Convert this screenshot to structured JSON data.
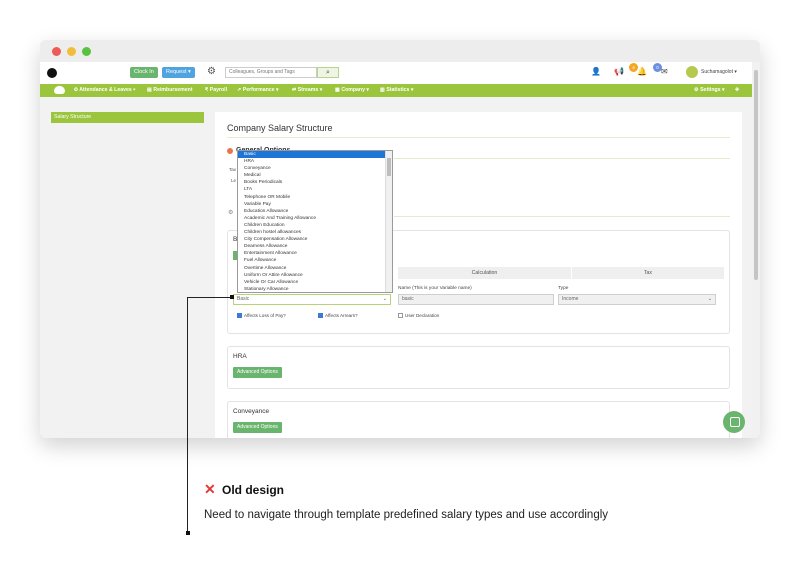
{
  "header": {
    "clock_in": "Clock In",
    "request": "Request ▾",
    "search_placeholder": "Colleagues, Groups and Tags",
    "notif_count_1": "4",
    "notif_count_2": "0",
    "username": "Suchamagolot ▾"
  },
  "nav": {
    "items": [
      "Attendance & Leaves ▾",
      "Reimbursement",
      "Payroll",
      "Performance ▾",
      "Streams ▾",
      "Company ▾",
      "Statistics ▾"
    ],
    "settings": "Settings ▾"
  },
  "sidebar": {
    "items": [
      {
        "label": "Salary Structure"
      }
    ]
  },
  "main": {
    "title": "Company Salary Structure",
    "section_general": "General Options",
    "general_label_1": "Tax",
    "general_label_2": "Le",
    "basic_panel": {
      "label": "B",
      "columns": [
        "Calculation",
        "Tax"
      ],
      "name_label": "Name (This is your Variable name)",
      "name_value": "basic",
      "type_label": "Type",
      "type_value": "Income",
      "select_value": "Basic",
      "chk1": "Affects Loss of Pay?",
      "chk2": "Affects Arrears?",
      "chk3": "User Declaration"
    },
    "hra_panel": {
      "title": "HRA",
      "button": "Advanced Options"
    },
    "conv_panel": {
      "title": "Conveyance",
      "button": "Advanced Options"
    }
  },
  "dropdown": {
    "options": [
      "Basic",
      "HRA",
      "Conveyance",
      "Medical",
      "Books Periodicals",
      "LTA",
      "Telephone OR Mobile",
      "Variable Pay",
      "Education Allowance",
      "Academic And Training Allowance",
      "Children Education",
      "Children hostel allowances",
      "City Compensation Allowance",
      "Dearness Allowance",
      "Entertainment Allowance",
      "Fuel Allowance",
      "Overtime Allowance",
      "Uniform Or Attire Allowance",
      "Vehicle Or Car Allowance",
      "Stationary Allowance"
    ],
    "selected_index": 0
  },
  "annotation": {
    "title": "Old design",
    "description": "Need to navigate through template predefined salary types and use accordingly"
  },
  "colors": {
    "nav_green": "#9bc53d",
    "button_green": "#6ab56d",
    "accent_blue": "#1d75d8",
    "error_red": "#e53935"
  }
}
